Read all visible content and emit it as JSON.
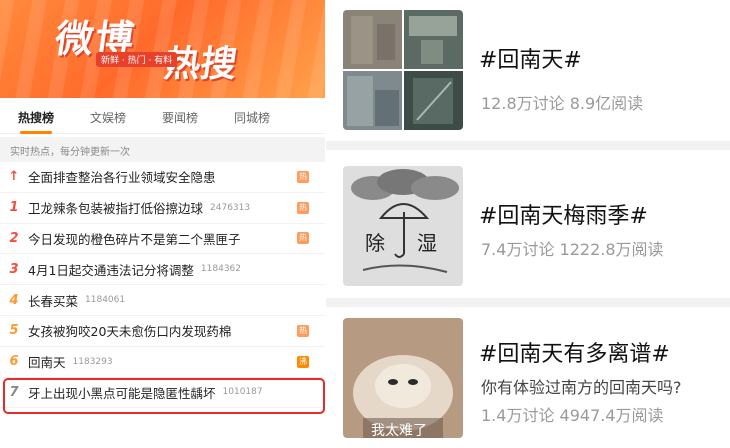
{
  "banner": {
    "logo_line1": "微博",
    "logo_line2": "热搜",
    "tagline": "新鲜 · 热门 · 有料"
  },
  "tabs": [
    {
      "label": "热搜榜",
      "active": true
    },
    {
      "label": "文娱榜",
      "active": false
    },
    {
      "label": "要闻榜",
      "active": false
    },
    {
      "label": "同城榜",
      "active": false
    }
  ],
  "subheader": "实时热点，每分钟更新一次",
  "hot_list": [
    {
      "rank": "↑",
      "title": "全面排查整治各行业领域安全隐患",
      "count": "",
      "badge": "热"
    },
    {
      "rank": "1",
      "title": "卫龙辣条包装被指打低俗擦边球",
      "count": "2476313",
      "badge": "热"
    },
    {
      "rank": "2",
      "title": "今日发现的橙色碎片不是第二个黑匣子",
      "count": "",
      "badge": "热"
    },
    {
      "rank": "3",
      "title": "4月1日起交通违法记分将调整",
      "count": "1184362",
      "badge": ""
    },
    {
      "rank": "4",
      "title": "长春买菜",
      "count": "1184061",
      "badge": ""
    },
    {
      "rank": "5",
      "title": "女孩被狗咬20天未愈伤口内发现药棉",
      "count": "",
      "badge": "热"
    },
    {
      "rank": "6",
      "title": "回南天",
      "count": "1183293",
      "badge": "沸"
    },
    {
      "rank": "7",
      "title": "牙上出现小黑点可能是隐匿性龋坏",
      "count": "1010187",
      "badge": ""
    }
  ],
  "topics": [
    {
      "title": "#回南天#",
      "subtitle": "",
      "meta": "12.8万讨论 8.9亿阅读"
    },
    {
      "title": "#回南天梅雨季#",
      "subtitle": "",
      "meta": "7.4万讨论 1222.8万阅读",
      "image_text": [
        "除",
        "湿"
      ]
    },
    {
      "title": "#回南天有多离谱#",
      "subtitle": "你有体验过南方的回南天吗?",
      "meta": "1.4万讨论 4947.4万阅读",
      "image_text": [
        "我太难了"
      ]
    }
  ]
}
